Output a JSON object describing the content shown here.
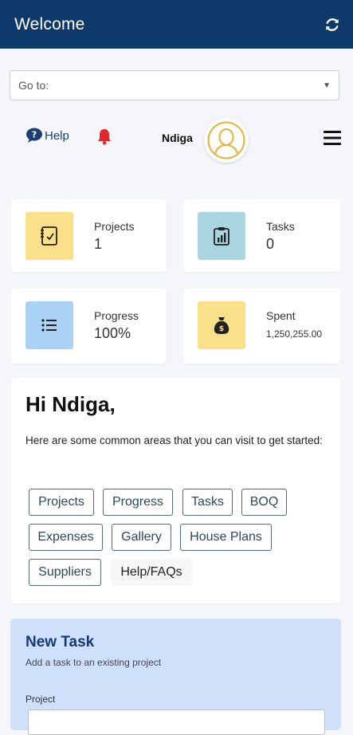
{
  "appbar": {
    "title": "Welcome",
    "refresh_icon": "refresh-icon"
  },
  "goto": {
    "value": "Go to:"
  },
  "toolbar": {
    "help_label": "Help",
    "user_name": "Ndiga"
  },
  "stats": [
    {
      "label": "Projects",
      "value": "1",
      "icon": "checklist-icon",
      "color": "#fbe08a"
    },
    {
      "label": "Tasks",
      "value": "0",
      "icon": "clipboard-chart-icon",
      "color": "#a9d6df"
    },
    {
      "label": "Progress",
      "value": "100%",
      "icon": "list-icon",
      "color": "#a9d2f4"
    },
    {
      "label": "Spent",
      "value": "1,250,255.00",
      "icon": "money-bag-icon",
      "color": "#fbe08a"
    }
  ],
  "welcome": {
    "greeting": "Hi Ndiga,",
    "subtitle": "Here are some common areas that you can visit to get started:",
    "links": [
      "Projects",
      "Progress",
      "Tasks",
      "BOQ",
      "Expenses",
      "Gallery",
      "House Plans",
      "Suppliers",
      "Help/FAQs"
    ]
  },
  "new_task": {
    "title": "New Task",
    "description": "Add a task to an existing project",
    "project_label": "Project"
  },
  "colors": {
    "appbar": "#0d3a6b",
    "accent": "#123a7a",
    "bell": "#e0282e",
    "avatar_ring": "#e8b23a"
  }
}
